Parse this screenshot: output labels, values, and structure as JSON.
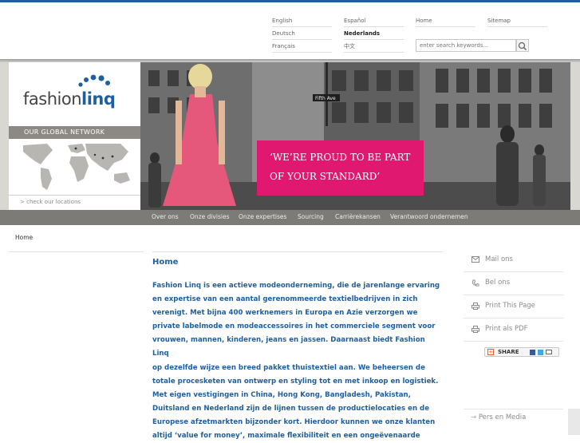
{
  "languages": [
    {
      "label": "English",
      "selected": false
    },
    {
      "label": "Español",
      "selected": false
    },
    {
      "label": "Deutsch",
      "selected": false
    },
    {
      "label": "Nederlands",
      "selected": true
    },
    {
      "label": "Français",
      "selected": false
    },
    {
      "label": "中文",
      "selected": false
    }
  ],
  "utility_links": {
    "home": "Home",
    "sitemap": "Sitemap"
  },
  "search": {
    "placeholder": "enter search keywords..."
  },
  "brand": {
    "name": "fashion",
    "name_accent": "linq",
    "accent_color": "#1f5fa0"
  },
  "banner": {
    "network_label": "OUR GLOBAL NETWORK",
    "locations_link": "> check our locations",
    "street_sign": "Fifth Ave",
    "quote_line1": "‘WE’RE PROUD TO BE PART",
    "quote_line2": "OF YOUR STANDARD’",
    "quote_color": "#e0186f"
  },
  "nav": [
    "Over ons",
    "Onze divisies",
    "Onze expertises",
    "Sourcing",
    "Carrièrekansen",
    "Verantwoord ondernemen"
  ],
  "breadcrumb": "Home",
  "main": {
    "title": "Home",
    "lines": [
      "Fashion Linq is een actieve modeonderneming, die de jarenlange ervaring",
      "en expertise van een aantal gerenommeerde textielbedrijven in zich",
      "verenigt. Met bijna 400 werknemers in Europa en Azie verzorgen we",
      "private labelmode en modeaccessoires in het commerciele segment voor",
      "vrouwen, mannen, kinderen, jeans en jassen. Daarnaast biedt Fashion Linq",
      "op dezelfde wijze een breed pakket thuistextiel aan. We beheersen de",
      "totale procesketen van ontwerp en styling tot en met inkoop en logistiek.",
      "Met eigen vestigingen in China, Hong Kong, Bangladesh, Pakistan,",
      "Duitsland en Nederland zijn de lijnen tussen de productielocaties en de",
      "Europese afzetmarkten bijzonder kort. Hierdoor kunnen we onze klanten",
      "altijd ‘value for money’, maximale flexibiliteit en een ongeëvenaarde"
    ]
  },
  "sidebar": {
    "actions": [
      {
        "label": "Mail ons",
        "icon": "mail-icon"
      },
      {
        "label": "Bel ons",
        "icon": "phone-icon"
      },
      {
        "label": "Print This Page",
        "icon": "print-icon"
      },
      {
        "label": "Print als PDF",
        "icon": "print-icon"
      }
    ],
    "share_label": "SHARE",
    "pers": "Pers en Media"
  }
}
